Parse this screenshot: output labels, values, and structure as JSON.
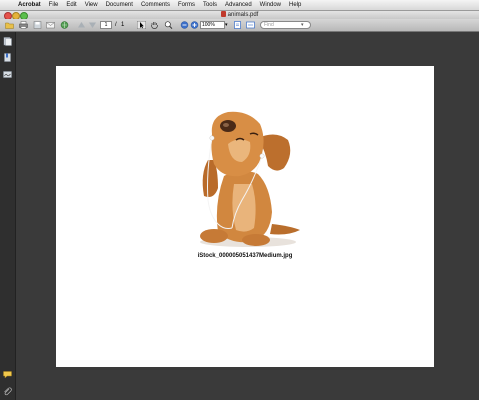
{
  "menubar": {
    "apple_glyph": "",
    "items": [
      "Acrobat",
      "File",
      "Edit",
      "View",
      "Document",
      "Comments",
      "Forms",
      "Tools",
      "Advanced",
      "Window",
      "Help"
    ]
  },
  "window": {
    "title": "animals.pdf"
  },
  "toolbar": {
    "page_current": "1",
    "page_separator": "/",
    "page_total": "1",
    "zoom_value": "100%",
    "zoom_arrow": "▾",
    "find_placeholder": "Find",
    "find_arrow": "▾"
  },
  "document": {
    "image_caption": "iStock_000005051437Medium.jpg"
  },
  "colors": {
    "workspace": "#3a3a3a",
    "page": "#ffffff"
  }
}
